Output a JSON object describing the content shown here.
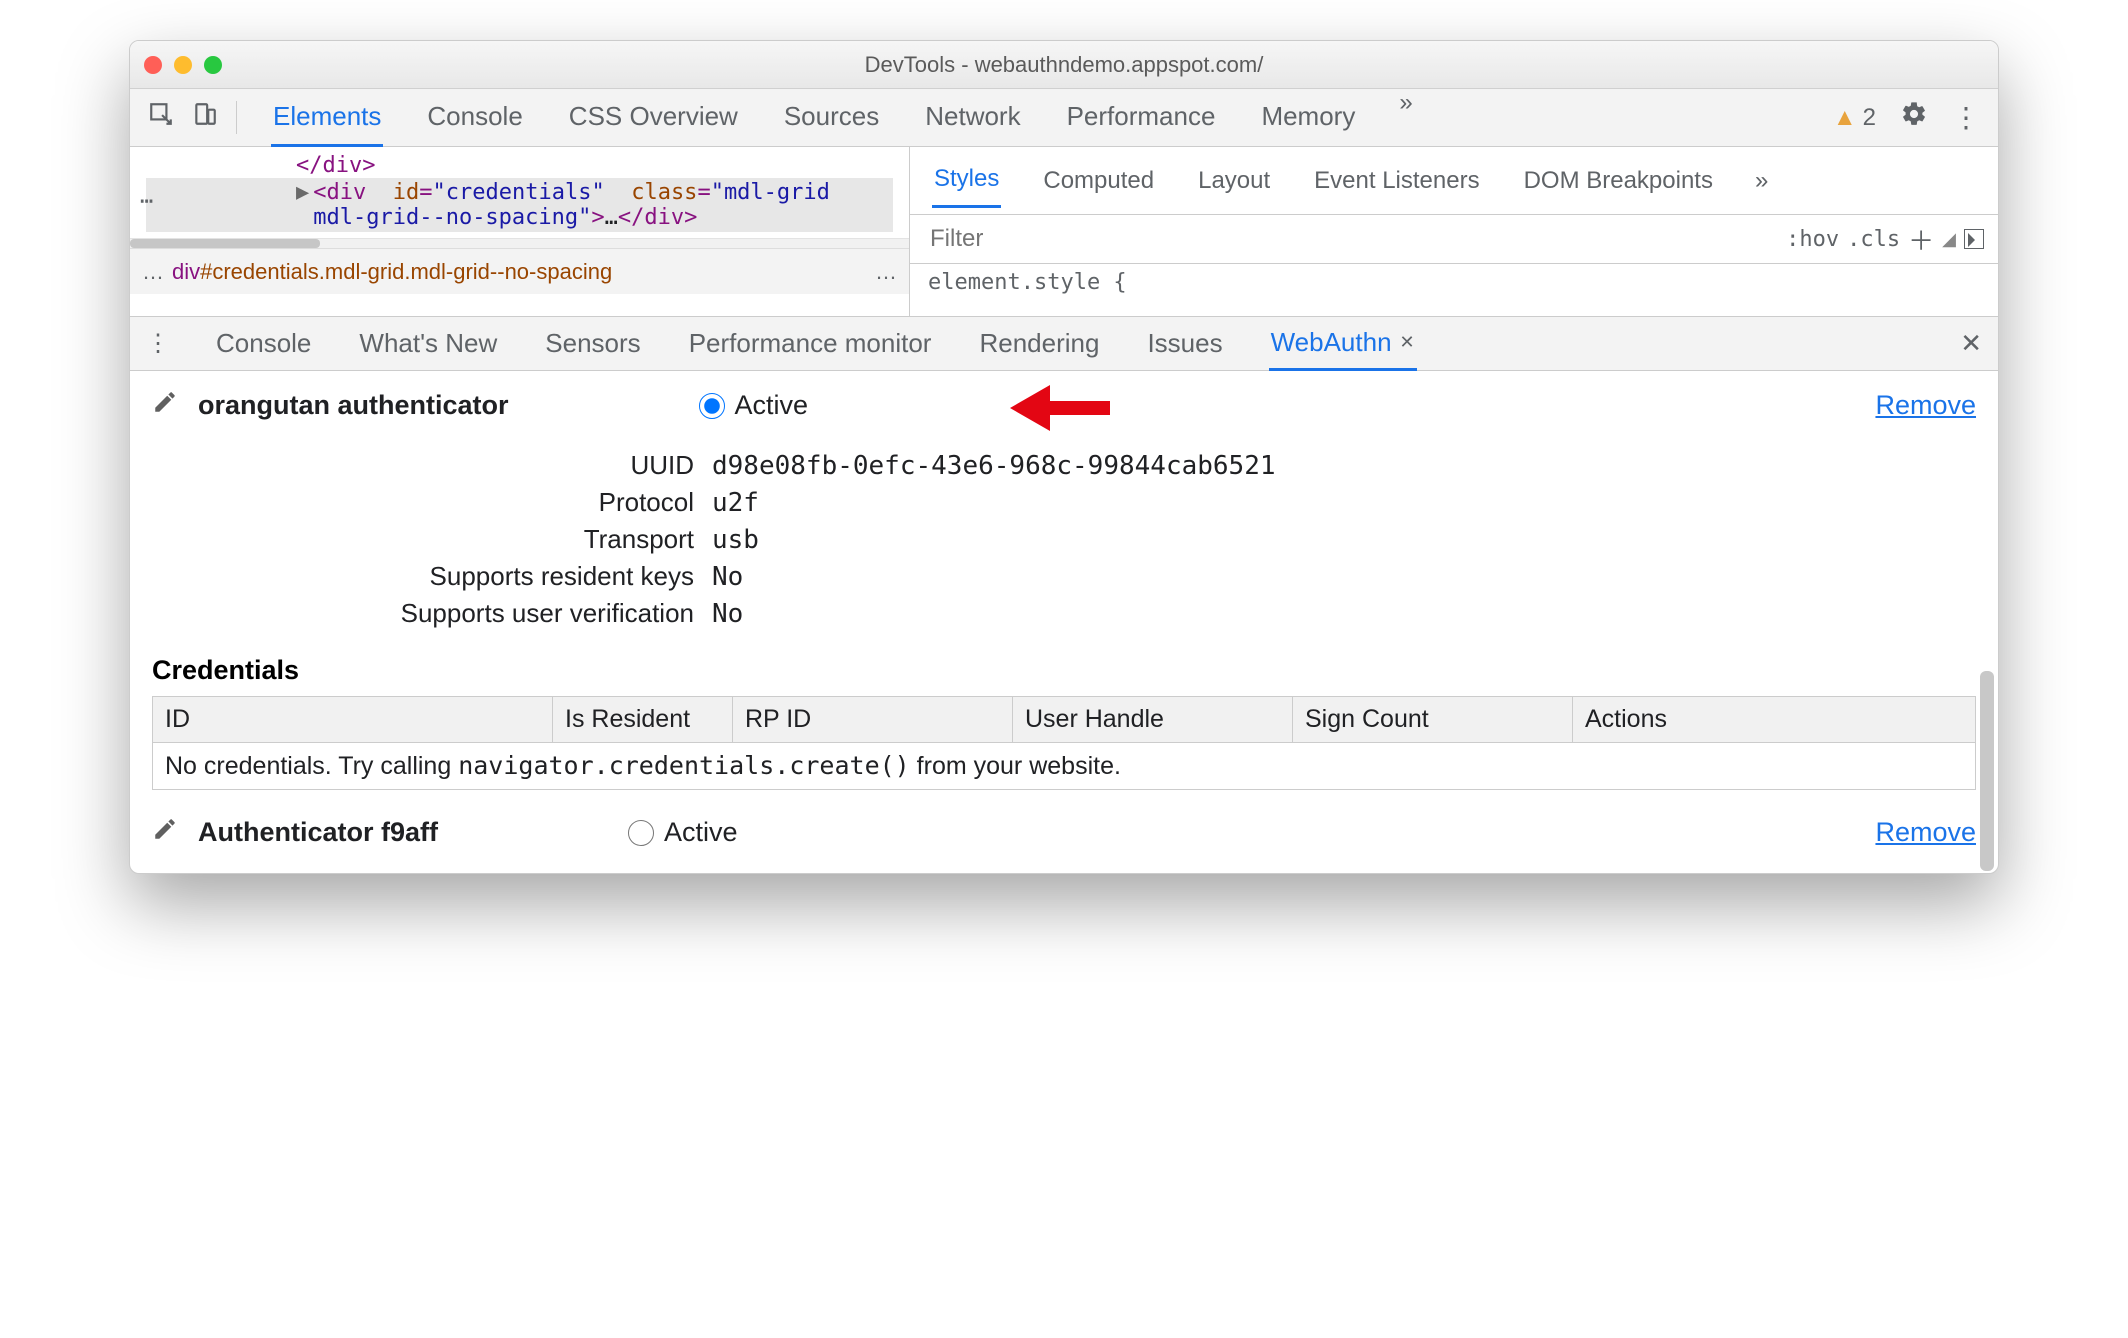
{
  "window": {
    "title": "DevTools - webauthndemo.appspot.com/"
  },
  "main_tabs": {
    "items": [
      "Elements",
      "Console",
      "CSS Overview",
      "Sources",
      "Network",
      "Performance",
      "Memory"
    ],
    "active": "Elements",
    "more_glyph": "»",
    "warning_count": "2"
  },
  "elements_panel": {
    "dom_line_close": "</div>",
    "dom_highlight": {
      "tag": "div",
      "id_attr": "id",
      "id_val": "credentials",
      "class_attr": "class",
      "class_val": "mdl-grid mdl-grid--no-spacing",
      "ellipsis": "…",
      "close": "</div>"
    },
    "breadcrumb_left": "…",
    "breadcrumb_text": "div#credentials.mdl-grid.mdl-grid--no-spacing",
    "breadcrumb_right": "…"
  },
  "styles_panel": {
    "tabs": [
      "Styles",
      "Computed",
      "Layout",
      "Event Listeners",
      "DOM Breakpoints"
    ],
    "active": "Styles",
    "more_glyph": "»",
    "filter_placeholder": "Filter",
    "hov": ":hov",
    "cls": ".cls",
    "element_style": "element.style {"
  },
  "drawer": {
    "kebab": "⋮",
    "tabs": [
      "Console",
      "What's New",
      "Sensors",
      "Performance monitor",
      "Rendering",
      "Issues",
      "WebAuthn"
    ],
    "active": "WebAuthn"
  },
  "webauthn": {
    "authenticators": [
      {
        "name": "orangutan authenticator",
        "active_label": "Active",
        "active": true,
        "remove_label": "Remove",
        "fields": {
          "UUID": "d98e08fb-0efc-43e6-968c-99844cab6521",
          "Protocol": "u2f",
          "Transport": "usb",
          "Supports resident keys": "No",
          "Supports user verification": "No"
        }
      },
      {
        "name": "Authenticator f9aff",
        "active_label": "Active",
        "active": false,
        "remove_label": "Remove"
      }
    ],
    "credentials": {
      "heading": "Credentials",
      "columns": [
        "ID",
        "Is Resident",
        "RP ID",
        "User Handle",
        "Sign Count",
        "Actions"
      ],
      "empty_prefix": "No credentials. Try calling ",
      "empty_code": "navigator.credentials.create()",
      "empty_suffix": " from your website."
    }
  }
}
